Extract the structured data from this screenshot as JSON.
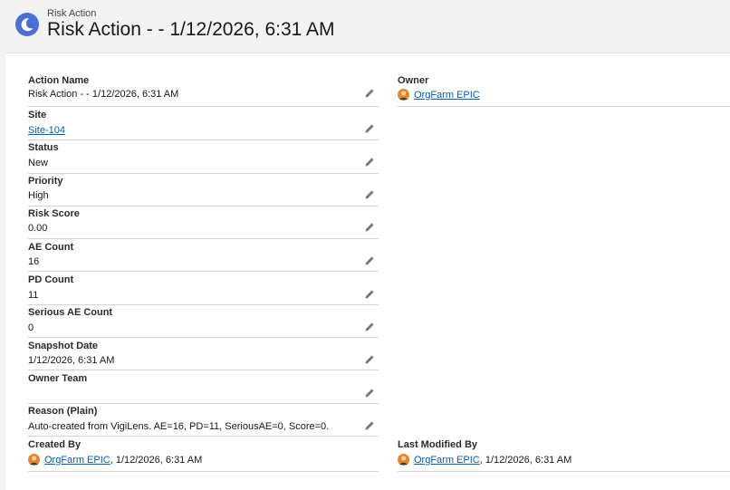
{
  "header": {
    "object_type": "Risk Action",
    "title": "Risk Action - - 1/12/2026, 6:31 AM"
  },
  "fields": {
    "action_name": {
      "label": "Action Name",
      "value": "Risk Action - - 1/12/2026, 6:31 AM"
    },
    "owner": {
      "label": "Owner",
      "value": "OrgFarm EPIC"
    },
    "site": {
      "label": "Site",
      "value": "Site-104"
    },
    "status": {
      "label": "Status",
      "value": "New"
    },
    "priority": {
      "label": "Priority",
      "value": "High"
    },
    "risk_score": {
      "label": "Risk Score",
      "value": "0.00"
    },
    "ae_count": {
      "label": "AE Count",
      "value": "16"
    },
    "pd_count": {
      "label": "PD Count",
      "value": "11"
    },
    "serious_ae_count": {
      "label": "Serious AE Count",
      "value": "0"
    },
    "snapshot_date": {
      "label": "Snapshot Date",
      "value": "1/12/2026, 6:31 AM"
    },
    "owner_team": {
      "label": "Owner Team",
      "value": ""
    },
    "reason_plain": {
      "label": "Reason (Plain)",
      "value": "Auto-created from VigiLens. AE=16, PD=11, SeriousAE=0, Score=0."
    },
    "created_by": {
      "label": "Created By",
      "user": "OrgFarm EPIC",
      "date": ", 1/12/2026, 6:31 AM"
    },
    "last_modified_by": {
      "label": "Last Modified By",
      "user": "OrgFarm EPIC",
      "date": ", 1/12/2026, 6:31 AM"
    }
  },
  "icons": {
    "header": "risk-action-moon-icon",
    "edit": "pencil-icon",
    "user": "user-avatar-icon"
  },
  "colors": {
    "header_icon_bg": "#4a6fd6",
    "link": "#0b5cab",
    "page_bg": "#f3f3f3"
  }
}
